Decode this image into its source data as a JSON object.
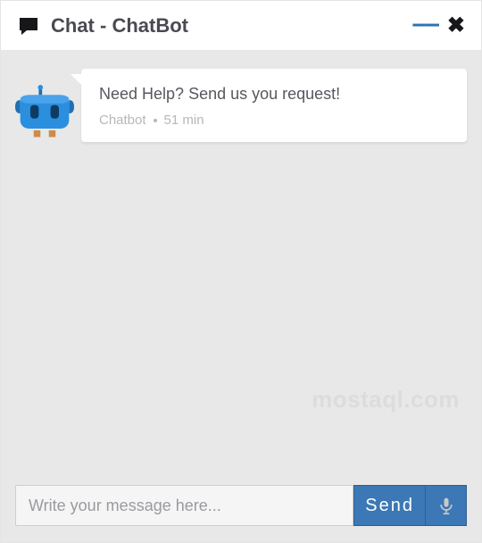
{
  "header": {
    "title": "Chat - ChatBot"
  },
  "message": {
    "text": "Need Help? Send us you request!",
    "sender": "Chatbot",
    "time": "51 min"
  },
  "composer": {
    "placeholder": "Write your message here...",
    "send_label": "Send"
  },
  "watermark": "mostaql.com",
  "colors": {
    "accent": "#3b78b5",
    "bot_primary": "#2b8fe0",
    "bot_dark": "#1f6fb3"
  }
}
